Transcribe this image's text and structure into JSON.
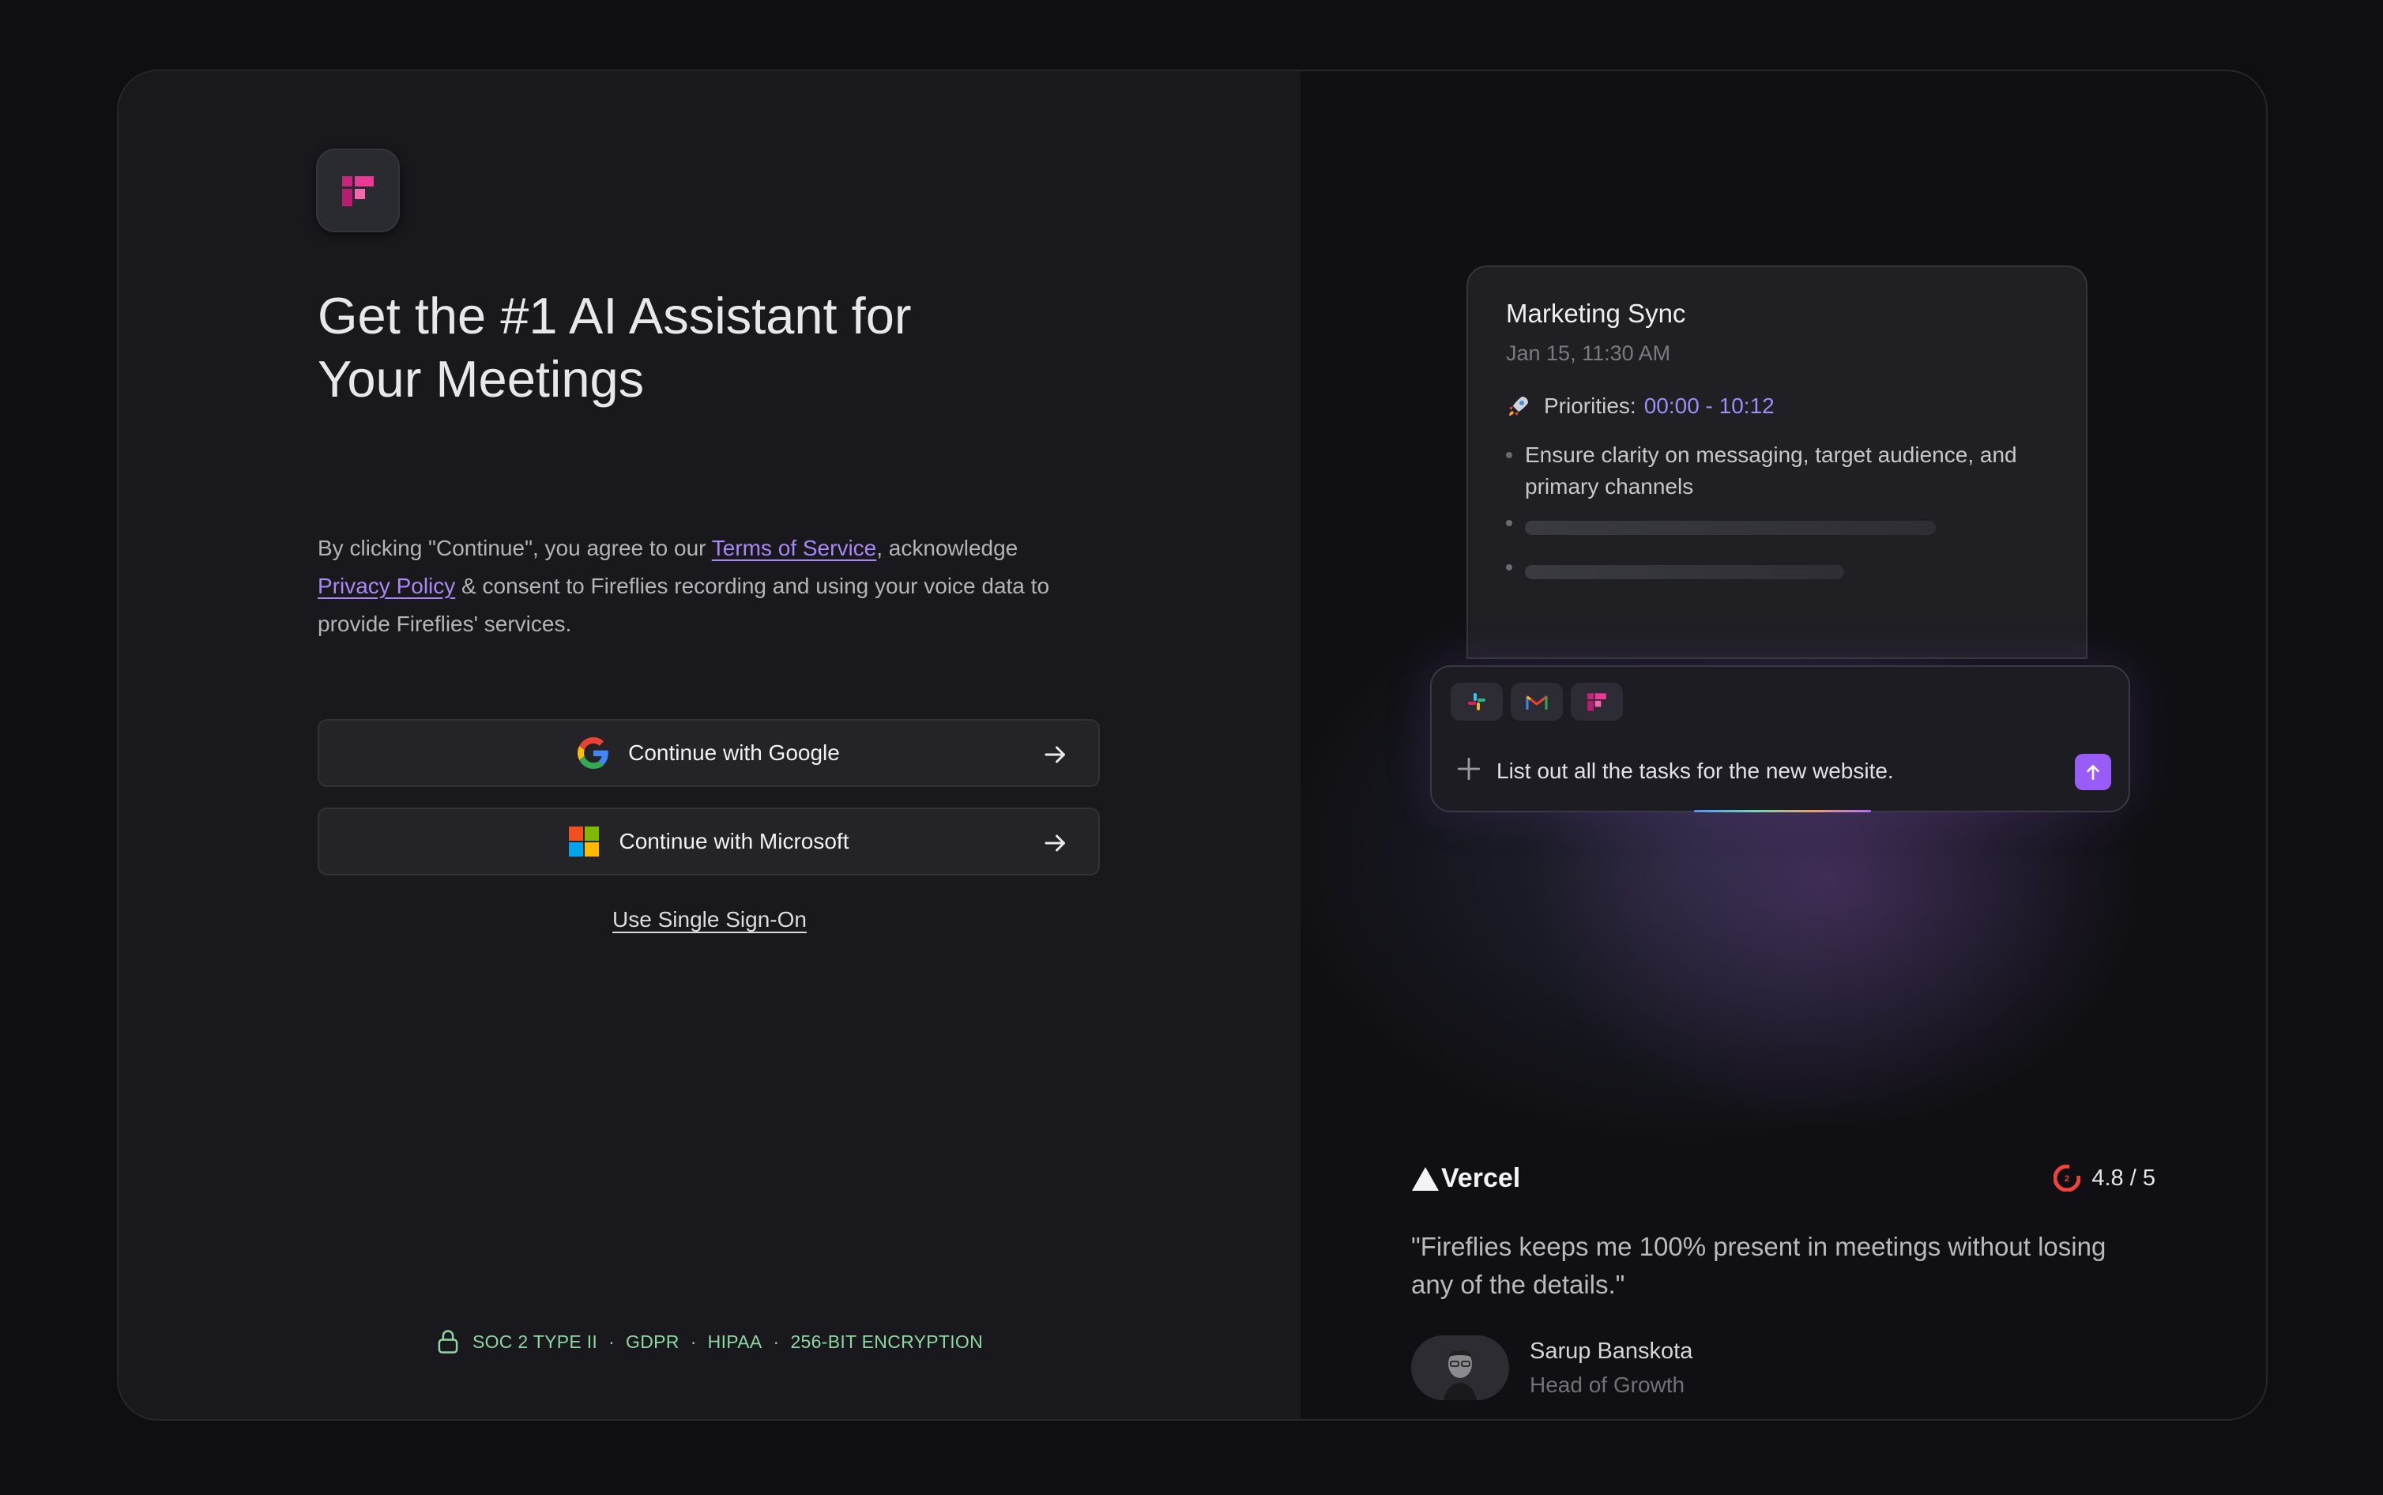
{
  "headline": {
    "line1": "Get the #1 AI Assistant for",
    "line2": "Your Meetings"
  },
  "consent": {
    "part1": "By clicking \"Continue\", you agree to our ",
    "terms_link": "Terms of Service",
    "part2": ", acknowledge",
    "privacy_link": "Privacy Policy",
    "part3": " & consent to Fireflies recording and using your voice data to provide Fireflies' services."
  },
  "auth": {
    "google_label": "Continue with Google",
    "microsoft_label": "Continue with Microsoft",
    "sso_label": "Use Single Sign-On"
  },
  "compliance": {
    "items": [
      "SOC 2 TYPE II",
      "GDPR",
      "HIPAA",
      "256-BIT ENCRYPTION"
    ],
    "separator": "·"
  },
  "meeting": {
    "title": "Marketing Sync",
    "date": "Jan 15, 11:30 AM",
    "priorities_label": "Priorities:",
    "priorities_time": "00:00 - 10:12",
    "bullet1": "Ensure clarity on messaging, target audience, and primary channels"
  },
  "composer": {
    "input_text": "List out all the tasks for the new website."
  },
  "testimonial": {
    "company": "Vercel",
    "rating": "4.8 / 5",
    "quote": "\"Fireflies keeps me 100% present in meetings without losing any of the details.\"",
    "name": "Sarup Banskota",
    "role": "Head of Growth"
  },
  "icons": {
    "logo": "fireflies-logo",
    "google": "google-icon",
    "microsoft": "microsoft-icon",
    "arrow": "arrow-right-icon",
    "lock": "lock-icon",
    "rocket": "rocket-icon",
    "slack": "slack-icon",
    "gmail": "gmail-icon",
    "plus": "plus-icon",
    "send": "arrow-up-icon",
    "g2": "g2-icon"
  },
  "colors": {
    "accent": "#9a5cf6",
    "link": "#a987f5",
    "compliance_green": "#8ed8a2",
    "brand_pink": "#e0328b"
  }
}
